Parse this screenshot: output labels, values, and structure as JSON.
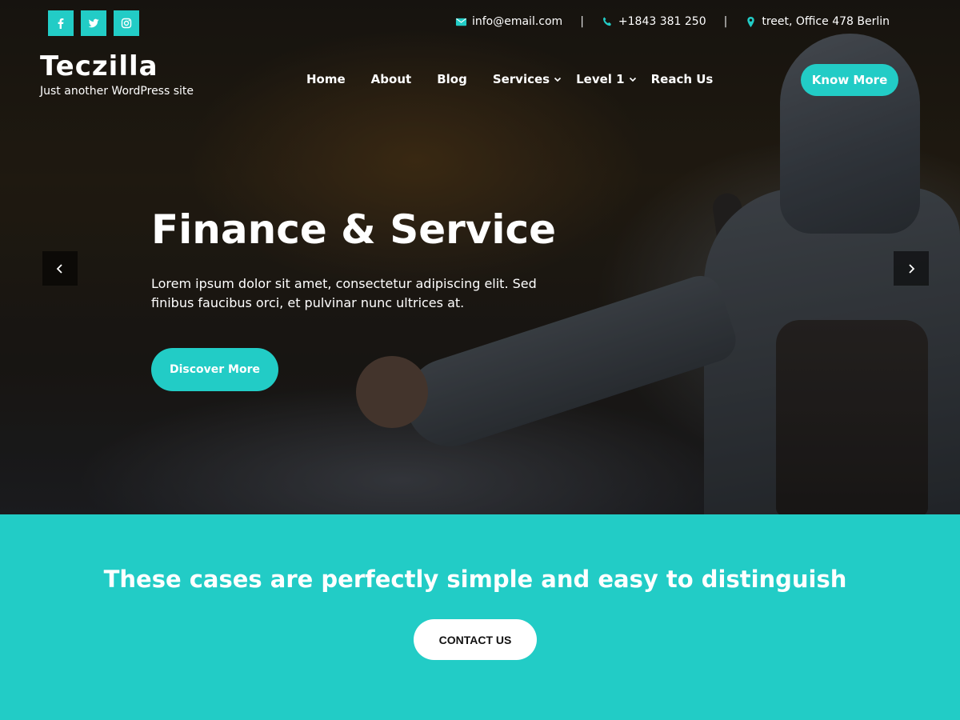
{
  "header": {
    "social": [
      {
        "icon": "facebook-icon",
        "label": "f"
      },
      {
        "icon": "twitter-icon",
        "label": "t"
      },
      {
        "icon": "instagram-icon",
        "label": "ig"
      }
    ],
    "email": "info@email.com",
    "phone": "+1843 381 250",
    "address": "treet, Office 478 Berlin",
    "separator": "|"
  },
  "brand": {
    "title": "Teczilla",
    "tagline": "Just another WordPress site"
  },
  "nav": {
    "items": [
      {
        "label": "Home"
      },
      {
        "label": "About"
      },
      {
        "label": "Blog"
      },
      {
        "label": "Services"
      },
      {
        "label": "Level 1"
      },
      {
        "label": "Reach Us"
      }
    ],
    "cta_label": "Know More"
  },
  "hero": {
    "title": "Finance & Service",
    "text": "Lorem ipsum dolor sit amet, consectetur adipiscing elit. Sed finibus faucibus orci, et pulvinar nunc ultrices at.",
    "button_label": "Discover More"
  },
  "cta": {
    "text": "These cases are perfectly simple and easy to distinguish",
    "button_label": "CONTACT US"
  },
  "colors": {
    "accent": "#22ccc6",
    "text_light": "#ffffff"
  }
}
